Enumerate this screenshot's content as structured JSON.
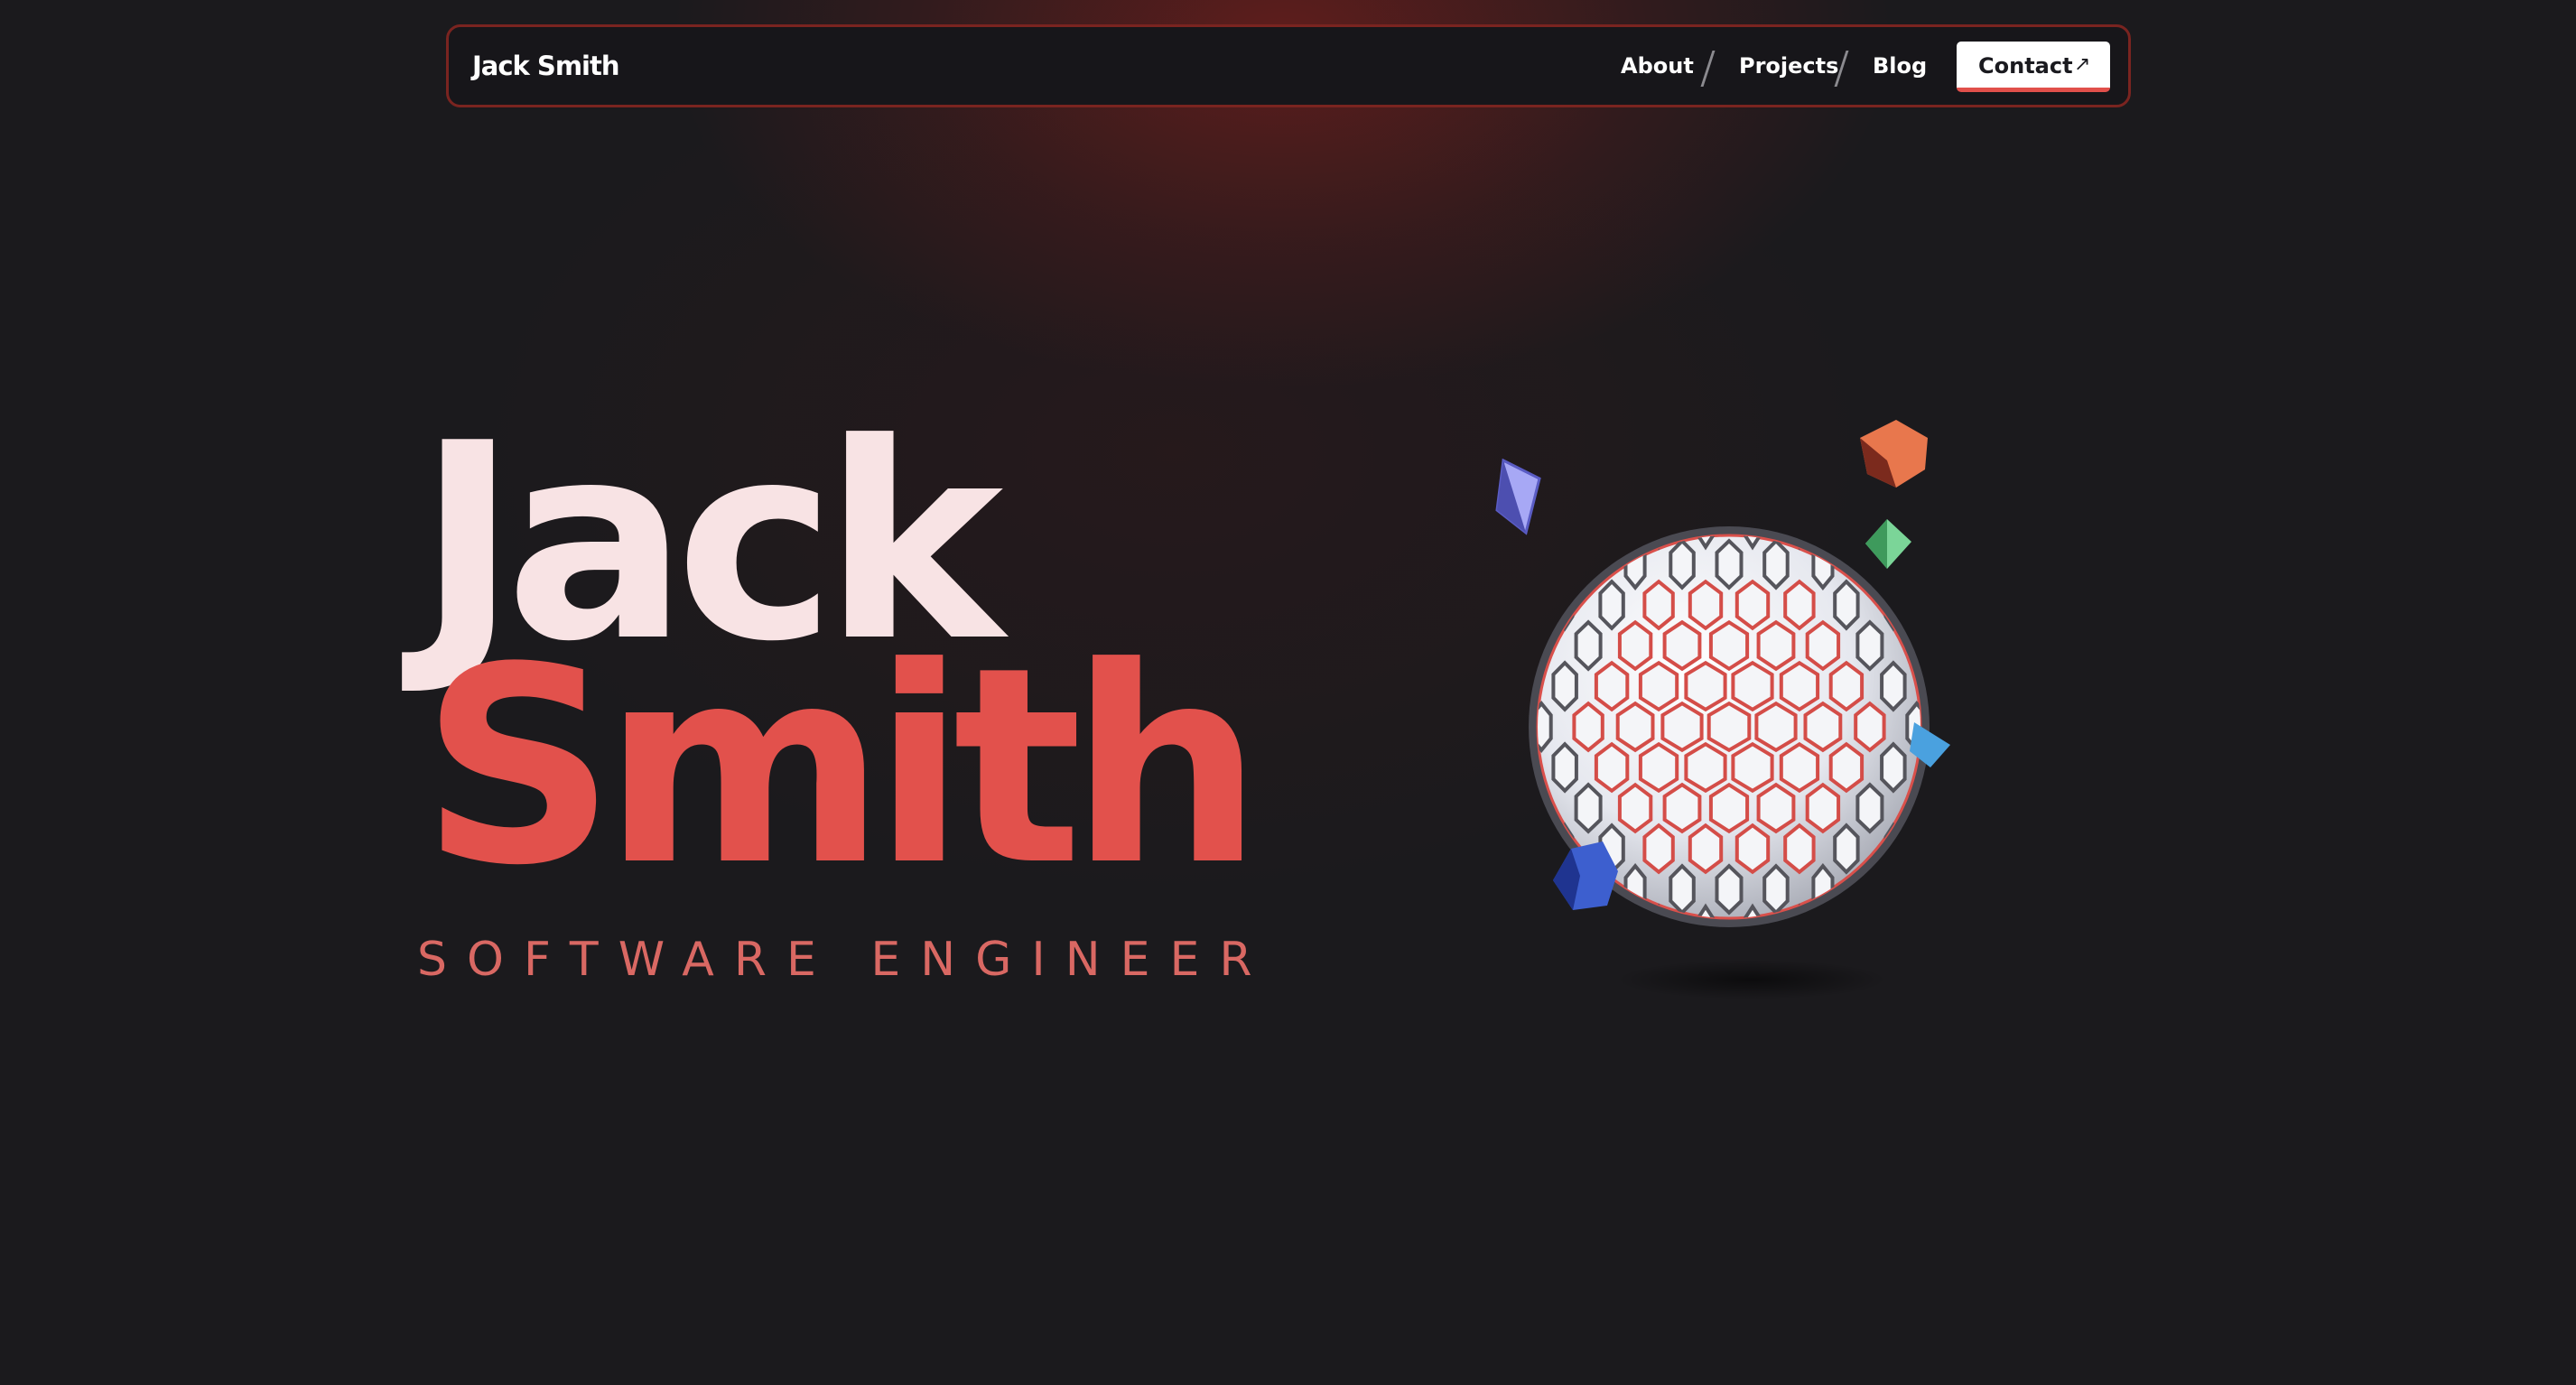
{
  "nav": {
    "brand": "Jack Smith",
    "links": [
      "About",
      "Projects",
      "Blog"
    ],
    "contact_label": "Contact",
    "contact_icon": "arrow-up-right-icon"
  },
  "hero": {
    "first_name": "Jack",
    "last_name": "Smith",
    "role": "SOFTWARE ENGINEER",
    "illustration": "hexagon-globe-3d-icon"
  },
  "colors": {
    "background": "#1b1a1d",
    "accent": "#e2514c",
    "first_name": "#f8e3e4",
    "nav_border": "#7a2420"
  }
}
